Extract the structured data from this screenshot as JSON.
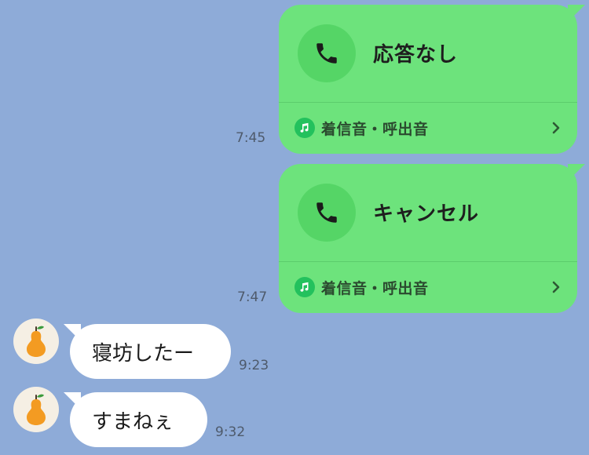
{
  "messages": [
    {
      "type": "call",
      "direction": "outgoing",
      "title": "応答なし",
      "ringtone_label": "着信音・呼出音",
      "time": "7:45"
    },
    {
      "type": "call",
      "direction": "outgoing",
      "title": "キャンセル",
      "ringtone_label": "着信音・呼出音",
      "time": "7:47"
    },
    {
      "type": "text",
      "direction": "incoming",
      "text": "寝坊したー",
      "time": "9:23"
    },
    {
      "type": "text",
      "direction": "incoming",
      "text": "すまねぇ",
      "time": "9:32"
    }
  ],
  "icons": {
    "call": "phone-icon",
    "ringtone": "music-note-icon",
    "chevron": "chevron-right-icon",
    "avatar": "pear-icon"
  },
  "colors": {
    "background": "#8eabd8",
    "outgoing_bubble": "#6de37c",
    "call_icon_circle": "#55d566",
    "ringtone_badge": "#23c15d",
    "incoming_bubble": "#ffffff",
    "avatar_background": "#f5efe4",
    "pear": "#f39b22"
  }
}
